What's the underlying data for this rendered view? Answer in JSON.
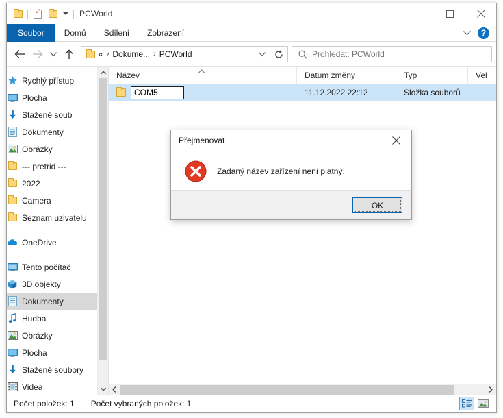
{
  "window": {
    "title": "PCWorld",
    "quick_access": [
      {
        "name": "folder-icon",
        "label": "Vlastnosti složky"
      },
      {
        "name": "properties-icon",
        "label": "Vlastnosti"
      },
      {
        "name": "new-folder-icon",
        "label": "Nová složka"
      }
    ],
    "controls": {
      "minimize": "Minimalizovat",
      "maximize": "Maximalizovat",
      "close": "Zavřít"
    }
  },
  "ribbon": {
    "tabs": [
      {
        "label": "Soubor",
        "active": true
      },
      {
        "label": "Domů",
        "active": false
      },
      {
        "label": "Sdílení",
        "active": false
      },
      {
        "label": "Zobrazení",
        "active": false
      }
    ],
    "collapse_label": "Minimalizovat pás karet",
    "help_label": "?"
  },
  "nav_toolbar": {
    "back": "Zpět",
    "forward": "Vpřed",
    "recent": "Poslední umístění",
    "up": "Nahoru",
    "refresh": "Aktualizovat",
    "breadcrumb": {
      "overflow": "«",
      "items": [
        "Dokume...",
        "PCWorld"
      ],
      "separator": "›"
    }
  },
  "search": {
    "placeholder": "Prohledat: PCWorld",
    "value": ""
  },
  "sidebar": {
    "groups": [
      {
        "header": {
          "label": "Rychlý přístup",
          "icon": "star-icon"
        },
        "items": [
          {
            "label": "Plocha",
            "icon": "desktop-icon",
            "pinned": true
          },
          {
            "label": "Stažené soub",
            "icon": "downloads-icon",
            "pinned": true
          },
          {
            "label": "Dokumenty",
            "icon": "documents-icon",
            "pinned": true
          },
          {
            "label": "Obrázky",
            "icon": "pictures-icon",
            "pinned": true
          },
          {
            "label": "--- pretrid ---",
            "icon": "folder-icon",
            "pinned": false
          },
          {
            "label": "2022",
            "icon": "folder-icon",
            "pinned": false
          },
          {
            "label": "Camera",
            "icon": "folder-icon",
            "pinned": false
          },
          {
            "label": "Seznam uzivatelu",
            "icon": "folder-icon",
            "pinned": false
          }
        ]
      },
      {
        "header": {
          "label": "OneDrive",
          "icon": "cloud-icon"
        },
        "items": []
      },
      {
        "header": {
          "label": "Tento počítač",
          "icon": "computer-icon"
        },
        "items": [
          {
            "label": "3D objekty",
            "icon": "3d-objects-icon",
            "selected": false
          },
          {
            "label": "Dokumenty",
            "icon": "documents-icon",
            "selected": true
          },
          {
            "label": "Hudba",
            "icon": "music-icon",
            "selected": false
          },
          {
            "label": "Obrázky",
            "icon": "pictures-icon",
            "selected": false
          },
          {
            "label": "Plocha",
            "icon": "desktop-icon",
            "selected": false
          },
          {
            "label": "Stažené soubory",
            "icon": "downloads-icon",
            "selected": false
          },
          {
            "label": "Videa",
            "icon": "videos-icon",
            "selected": false
          }
        ]
      }
    ]
  },
  "file_list": {
    "columns": [
      {
        "label": "Název",
        "sorted": "asc"
      },
      {
        "label": "Datum změny",
        "sorted": ""
      },
      {
        "label": "Typ",
        "sorted": ""
      },
      {
        "label": "Vel",
        "sorted": ""
      }
    ],
    "rows": [
      {
        "name": "COM5",
        "date": "11.12.2022 22:12",
        "type": "Složka souborů",
        "size": "",
        "selected": true,
        "renaming": true
      }
    ]
  },
  "status_bar": {
    "item_count": "Počet položek: 1",
    "selected_count": "Počet vybraných položek: 1",
    "views": [
      {
        "name": "details-view",
        "label": "Zobrazit podrobnosti",
        "active": true
      },
      {
        "name": "large-icons-view",
        "label": "Zobrazit velké ikony",
        "active": false
      }
    ]
  },
  "dialog": {
    "title": "Přejmenovat",
    "message": "Zadaný název zařízení není platný.",
    "icon": "error-icon",
    "close_label": "Zavřít",
    "ok_label": "OK"
  },
  "colors": {
    "accent": "#0a64ad",
    "selection": "#cce4f7",
    "error": "#e03a24",
    "folder": "#fcd77a"
  }
}
